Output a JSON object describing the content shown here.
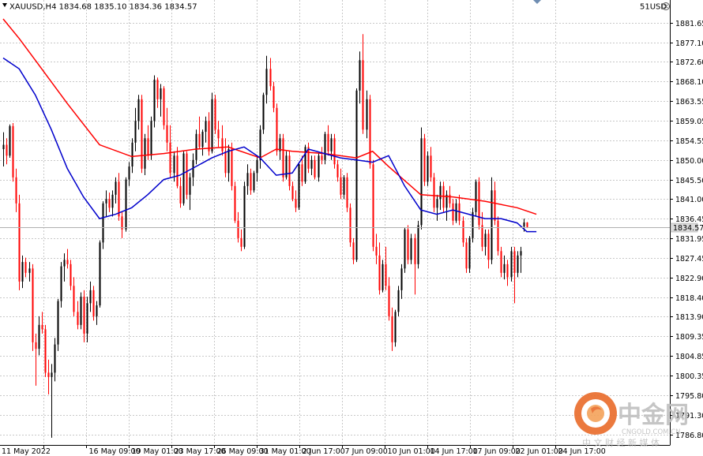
{
  "chart_data": {
    "type": "candlestick",
    "symbol_header": "XAUUSD,H4  1834.68 1835.10 1834.36 1834.57",
    "top_right_label": "51USD",
    "current_price_label": "1834.57",
    "current_price": 1834.57,
    "ylim": [
      1786.8,
      1884.5
    ],
    "y_ticks": [
      "1881.65",
      "1877.10",
      "1872.60",
      "1868.10",
      "1863.55",
      "1859.05",
      "1854.55",
      "1850.00",
      "1845.50",
      "1841.00",
      "1836.45",
      "1831.95",
      "1827.45",
      "1822.90",
      "1818.40",
      "1813.90",
      "1809.35",
      "1804.85",
      "1800.35",
      "1795.80",
      "1791.30",
      "1786.80"
    ],
    "x_ticks": [
      "11 May 2022",
      "16 May 09:00",
      "19 May 01:00",
      "23 May 17:00",
      "26 May 09:00",
      "31 May 01:00",
      "2 Jun 17:00",
      "7 Jun 09:00",
      "10 Jun 01:00",
      "14 Jun 17:00",
      "17 Jun 09:00",
      "22 Jun 01:00",
      "24 Jun 17:00"
    ],
    "bar_count": 166,
    "up_color": "#000000",
    "down_color": "#ff0000",
    "grid": true,
    "candles": [
      [
        1852.5,
        1856.4,
        1848.5,
        1853.5
      ],
      [
        1853.5,
        1855.0,
        1849.0,
        1851.0
      ],
      [
        1851.0,
        1858.2,
        1850.5,
        1857.8
      ],
      [
        1857.8,
        1858.5,
        1845.0,
        1846.0
      ],
      [
        1846.0,
        1848.0,
        1838.0,
        1840.0
      ],
      [
        1840.0,
        1842.0,
        1820.0,
        1822.0
      ],
      [
        1822.0,
        1828.0,
        1820.5,
        1826.5
      ],
      [
        1826.5,
        1827.5,
        1823.0,
        1824.0
      ],
      [
        1824.0,
        1826.5,
        1822.0,
        1825.0
      ],
      [
        1825.0,
        1826.0,
        1806.0,
        1808.0
      ],
      [
        1808.0,
        1810.0,
        1798.0,
        1806.5
      ],
      [
        1806.5,
        1814.0,
        1805.0,
        1812.0
      ],
      [
        1812.0,
        1815.0,
        1810.0,
        1811.0
      ],
      [
        1811.0,
        1812.0,
        1800.0,
        1801.0
      ],
      [
        1801.0,
        1804.0,
        1796.0,
        1800.0
      ],
      [
        1800.0,
        1803.0,
        1786.0,
        1801.0
      ],
      [
        1801.0,
        1809.0,
        1799.0,
        1807.5
      ],
      [
        1807.5,
        1818.0,
        1806.0,
        1817.5
      ],
      [
        1817.5,
        1826.5,
        1816.0,
        1825.5
      ],
      [
        1825.5,
        1828.5,
        1822.0,
        1827.0
      ],
      [
        1827.0,
        1829.5,
        1825.0,
        1826.0
      ],
      [
        1826.0,
        1827.0,
        1820.0,
        1821.0
      ],
      [
        1821.0,
        1823.0,
        1814.0,
        1815.0
      ],
      [
        1815.0,
        1817.5,
        1811.0,
        1812.0
      ],
      [
        1812.0,
        1819.5,
        1811.0,
        1818.5
      ],
      [
        1818.5,
        1820.0,
        1808.0,
        1810.0
      ],
      [
        1810.0,
        1818.5,
        1808.0,
        1817.0
      ],
      [
        1817.0,
        1822.0,
        1815.0,
        1820.0
      ],
      [
        1820.0,
        1821.0,
        1813.0,
        1814.0
      ],
      [
        1814.0,
        1817.5,
        1812.0,
        1816.5
      ],
      [
        1816.5,
        1831.5,
        1816.0,
        1831.0
      ],
      [
        1831.0,
        1840.5,
        1829.5,
        1840.0
      ],
      [
        1840.0,
        1843.0,
        1837.0,
        1841.0
      ],
      [
        1841.0,
        1842.5,
        1838.0,
        1839.0
      ],
      [
        1839.0,
        1843.0,
        1837.0,
        1842.0
      ],
      [
        1842.0,
        1846.0,
        1840.0,
        1845.0
      ],
      [
        1845.0,
        1847.0,
        1836.0,
        1837.0
      ],
      [
        1837.0,
        1838.0,
        1832.0,
        1834.0
      ],
      [
        1834.0,
        1846.0,
        1833.5,
        1845.5
      ],
      [
        1845.5,
        1849.5,
        1844.0,
        1848.5
      ],
      [
        1848.5,
        1855.0,
        1847.0,
        1854.0
      ],
      [
        1854.0,
        1862.0,
        1852.0,
        1859.0
      ],
      [
        1859.0,
        1865.0,
        1857.0,
        1864.0
      ],
      [
        1864.0,
        1865.0,
        1847.0,
        1848.0
      ],
      [
        1848.0,
        1856.0,
        1846.5,
        1855.0
      ],
      [
        1855.0,
        1858.0,
        1850.0,
        1851.0
      ],
      [
        1851.0,
        1860.0,
        1850.0,
        1859.0
      ],
      [
        1859.0,
        1869.5,
        1857.5,
        1868.5
      ],
      [
        1868.5,
        1869.0,
        1862.0,
        1864.0
      ],
      [
        1864.0,
        1867.5,
        1860.0,
        1866.5
      ],
      [
        1866.5,
        1867.0,
        1857.0,
        1858.0
      ],
      [
        1858.0,
        1862.0,
        1852.0,
        1854.0
      ],
      [
        1854.0,
        1858.0,
        1846.0,
        1847.0
      ],
      [
        1847.0,
        1852.0,
        1845.0,
        1851.0
      ],
      [
        1851.0,
        1853.0,
        1843.5,
        1844.0
      ],
      [
        1844.0,
        1846.0,
        1839.0,
        1840.0
      ],
      [
        1840.0,
        1852.0,
        1839.5,
        1851.5
      ],
      [
        1851.5,
        1852.0,
        1841.0,
        1842.0
      ],
      [
        1842.0,
        1847.0,
        1838.5,
        1846.0
      ],
      [
        1846.0,
        1851.5,
        1844.0,
        1850.0
      ],
      [
        1850.0,
        1857.0,
        1849.0,
        1856.0
      ],
      [
        1856.0,
        1860.0,
        1852.5,
        1853.0
      ],
      [
        1853.0,
        1857.0,
        1851.0,
        1856.5
      ],
      [
        1856.5,
        1860.0,
        1854.0,
        1859.0
      ],
      [
        1859.0,
        1861.0,
        1851.0,
        1852.0
      ],
      [
        1852.0,
        1865.5,
        1851.5,
        1864.0
      ],
      [
        1864.0,
        1865.0,
        1856.0,
        1857.0
      ],
      [
        1857.0,
        1859.0,
        1853.0,
        1855.0
      ],
      [
        1855.0,
        1858.0,
        1851.0,
        1852.0
      ],
      [
        1852.0,
        1855.0,
        1846.0,
        1847.0
      ],
      [
        1847.0,
        1853.5,
        1845.0,
        1852.5
      ],
      [
        1852.5,
        1854.0,
        1843.0,
        1844.0
      ],
      [
        1844.0,
        1845.0,
        1835.5,
        1836.0
      ],
      [
        1836.0,
        1838.0,
        1831.0,
        1832.0
      ],
      [
        1832.0,
        1834.0,
        1829.0,
        1830.0
      ],
      [
        1830.0,
        1845.0,
        1829.5,
        1844.0
      ],
      [
        1844.0,
        1849.0,
        1842.0,
        1847.0
      ],
      [
        1847.0,
        1848.0,
        1842.0,
        1843.0
      ],
      [
        1843.0,
        1847.5,
        1842.5,
        1847.0
      ],
      [
        1847.0,
        1851.0,
        1845.0,
        1850.0
      ],
      [
        1850.0,
        1858.0,
        1848.0,
        1857.0
      ],
      [
        1857.0,
        1865.5,
        1856.0,
        1865.0
      ],
      [
        1865.0,
        1874.0,
        1863.0,
        1871.0
      ],
      [
        1871.0,
        1873.5,
        1866.0,
        1867.0
      ],
      [
        1867.0,
        1868.0,
        1861.0,
        1862.0
      ],
      [
        1862.0,
        1863.0,
        1851.0,
        1852.0
      ],
      [
        1852.0,
        1856.0,
        1850.0,
        1855.0
      ],
      [
        1855.0,
        1856.0,
        1845.0,
        1846.0
      ],
      [
        1846.0,
        1852.0,
        1845.5,
        1851.0
      ],
      [
        1851.0,
        1852.0,
        1843.0,
        1844.0
      ],
      [
        1844.0,
        1845.0,
        1840.5,
        1841.0
      ],
      [
        1841.0,
        1843.0,
        1838.0,
        1839.0
      ],
      [
        1839.0,
        1849.5,
        1838.5,
        1849.0
      ],
      [
        1849.0,
        1851.0,
        1844.0,
        1845.0
      ],
      [
        1845.0,
        1853.5,
        1844.5,
        1853.0
      ],
      [
        1853.0,
        1854.0,
        1847.0,
        1848.0
      ],
      [
        1848.0,
        1851.0,
        1846.5,
        1850.0
      ],
      [
        1850.0,
        1851.0,
        1845.5,
        1846.0
      ],
      [
        1846.0,
        1851.5,
        1845.0,
        1851.0
      ],
      [
        1851.0,
        1853.0,
        1849.0,
        1850.0
      ],
      [
        1850.0,
        1856.5,
        1849.0,
        1856.0
      ],
      [
        1856.0,
        1858.0,
        1851.0,
        1852.0
      ],
      [
        1852.0,
        1856.0,
        1850.0,
        1855.0
      ],
      [
        1855.0,
        1856.0,
        1848.0,
        1849.0
      ],
      [
        1849.0,
        1850.0,
        1845.0,
        1846.0
      ],
      [
        1846.0,
        1848.0,
        1841.0,
        1842.0
      ],
      [
        1842.0,
        1846.5,
        1841.0,
        1846.0
      ],
      [
        1846.0,
        1847.0,
        1838.0,
        1839.0
      ],
      [
        1839.0,
        1840.0,
        1830.0,
        1831.0
      ],
      [
        1831.0,
        1832.0,
        1826.0,
        1827.0
      ],
      [
        1827.0,
        1866.5,
        1826.5,
        1866.0
      ],
      [
        1866.0,
        1875.0,
        1863.0,
        1873.0
      ],
      [
        1873.0,
        1879.0,
        1856.0,
        1857.0
      ],
      [
        1857.0,
        1866.0,
        1855.0,
        1864.0
      ],
      [
        1864.0,
        1865.0,
        1848.0,
        1849.0
      ],
      [
        1849.0,
        1850.0,
        1829.0,
        1830.0
      ],
      [
        1830.0,
        1833.0,
        1826.0,
        1828.0
      ],
      [
        1828.0,
        1831.0,
        1819.0,
        1820.0
      ],
      [
        1820.0,
        1827.0,
        1819.5,
        1826.0
      ],
      [
        1826.0,
        1830.0,
        1820.0,
        1821.0
      ],
      [
        1821.0,
        1823.0,
        1813.0,
        1814.0
      ],
      [
        1814.0,
        1816.0,
        1806.0,
        1808.0
      ],
      [
        1808.0,
        1815.5,
        1807.0,
        1815.0
      ],
      [
        1815.0,
        1821.0,
        1814.0,
        1820.0
      ],
      [
        1820.0,
        1826.0,
        1818.0,
        1825.0
      ],
      [
        1825.0,
        1834.5,
        1824.0,
        1834.0
      ],
      [
        1834.0,
        1835.0,
        1826.0,
        1827.0
      ],
      [
        1827.0,
        1833.0,
        1826.0,
        1832.0
      ],
      [
        1832.0,
        1833.0,
        1819.0,
        1826.0
      ],
      [
        1826.0,
        1836.0,
        1825.0,
        1835.0
      ],
      [
        1835.0,
        1857.5,
        1834.0,
        1855.0
      ],
      [
        1855.0,
        1856.0,
        1844.0,
        1845.0
      ],
      [
        1845.0,
        1852.0,
        1844.0,
        1851.0
      ],
      [
        1851.0,
        1853.0,
        1845.0,
        1846.0
      ],
      [
        1846.0,
        1847.0,
        1838.0,
        1839.0
      ],
      [
        1839.0,
        1842.0,
        1836.0,
        1841.0
      ],
      [
        1841.0,
        1845.0,
        1838.5,
        1844.0
      ],
      [
        1844.0,
        1845.0,
        1838.0,
        1839.0
      ],
      [
        1839.0,
        1843.0,
        1836.0,
        1842.0
      ],
      [
        1842.0,
        1844.0,
        1839.0,
        1840.0
      ],
      [
        1840.0,
        1841.0,
        1835.0,
        1836.0
      ],
      [
        1836.0,
        1841.0,
        1835.5,
        1840.0
      ],
      [
        1840.0,
        1842.0,
        1835.0,
        1836.0
      ],
      [
        1836.0,
        1837.0,
        1830.0,
        1831.0
      ],
      [
        1831.0,
        1832.0,
        1824.0,
        1825.0
      ],
      [
        1825.0,
        1832.5,
        1824.0,
        1832.0
      ],
      [
        1832.0,
        1839.0,
        1831.0,
        1838.0
      ],
      [
        1838.0,
        1845.5,
        1837.0,
        1845.0
      ],
      [
        1845.0,
        1846.0,
        1834.0,
        1835.0
      ],
      [
        1835.0,
        1838.0,
        1829.0,
        1830.0
      ],
      [
        1830.0,
        1834.0,
        1828.0,
        1833.0
      ],
      [
        1833.0,
        1834.0,
        1825.0,
        1827.0
      ],
      [
        1827.0,
        1846.0,
        1826.0,
        1843.0
      ],
      [
        1843.0,
        1845.0,
        1835.0,
        1836.0
      ],
      [
        1836.0,
        1837.0,
        1828.0,
        1829.0
      ],
      [
        1829.0,
        1830.0,
        1823.0,
        1824.0
      ],
      [
        1824.0,
        1828.0,
        1822.5,
        1826.0
      ],
      [
        1826.0,
        1827.0,
        1821.0,
        1823.0
      ],
      [
        1823.0,
        1830.0,
        1822.0,
        1829.0
      ],
      [
        1829.0,
        1830.0,
        1817.0,
        1824.0
      ],
      [
        1824.0,
        1829.0,
        1823.0,
        1828.0
      ],
      [
        1828.0,
        1830.0,
        1824.0,
        1829.0
      ],
      [
        1834.68,
        1836.5,
        1833.5,
        1835.6
      ],
      [
        1835.6,
        1835.7,
        1834.3,
        1834.57
      ]
    ],
    "series": [
      {
        "color": "#ff0000",
        "x": [
          0,
          5,
          10,
          20,
          30,
          40,
          50,
          60,
          70,
          80,
          85,
          90,
          100,
          110,
          115,
          120,
          130,
          140,
          150,
          160,
          166
        ],
        "values": [
          1882.5,
          1878.0,
          1873.0,
          1863.0,
          1853.5,
          1850.8,
          1851.5,
          1852.5,
          1853.0,
          1850.5,
          1852.5,
          1852.0,
          1851.5,
          1850.5,
          1852.0,
          1848.5,
          1842.0,
          1841.5,
          1840.5,
          1839.0,
          1837.5
        ]
      },
      {
        "color": "#0000cc",
        "x": [
          0,
          5,
          10,
          15,
          20,
          25,
          30,
          35,
          40,
          45,
          50,
          55,
          60,
          65,
          70,
          75,
          80,
          85,
          90,
          95,
          100,
          105,
          110,
          115,
          120,
          125,
          130,
          135,
          140,
          145,
          150,
          155,
          160,
          163,
          166
        ],
        "values": [
          1873.5,
          1871.0,
          1865.0,
          1857.0,
          1848.0,
          1841.5,
          1836.5,
          1837.5,
          1839.0,
          1842.0,
          1845.5,
          1846.5,
          1848.5,
          1850.5,
          1852.0,
          1853.0,
          1850.5,
          1846.5,
          1847.0,
          1852.5,
          1851.5,
          1850.5,
          1850.0,
          1849.5,
          1851.0,
          1844.0,
          1838.5,
          1837.5,
          1838.5,
          1837.5,
          1836.5,
          1836.5,
          1835.5,
          1833.5,
          1833.5
        ]
      }
    ]
  },
  "watermark": {
    "brand": "中金网",
    "url": "CNGOLD.COM.CN",
    "tagline": "中 文 财 经 新 媒 体"
  },
  "icons": {
    "collapse": "triangle-down-icon",
    "close": "close-circle-icon"
  }
}
